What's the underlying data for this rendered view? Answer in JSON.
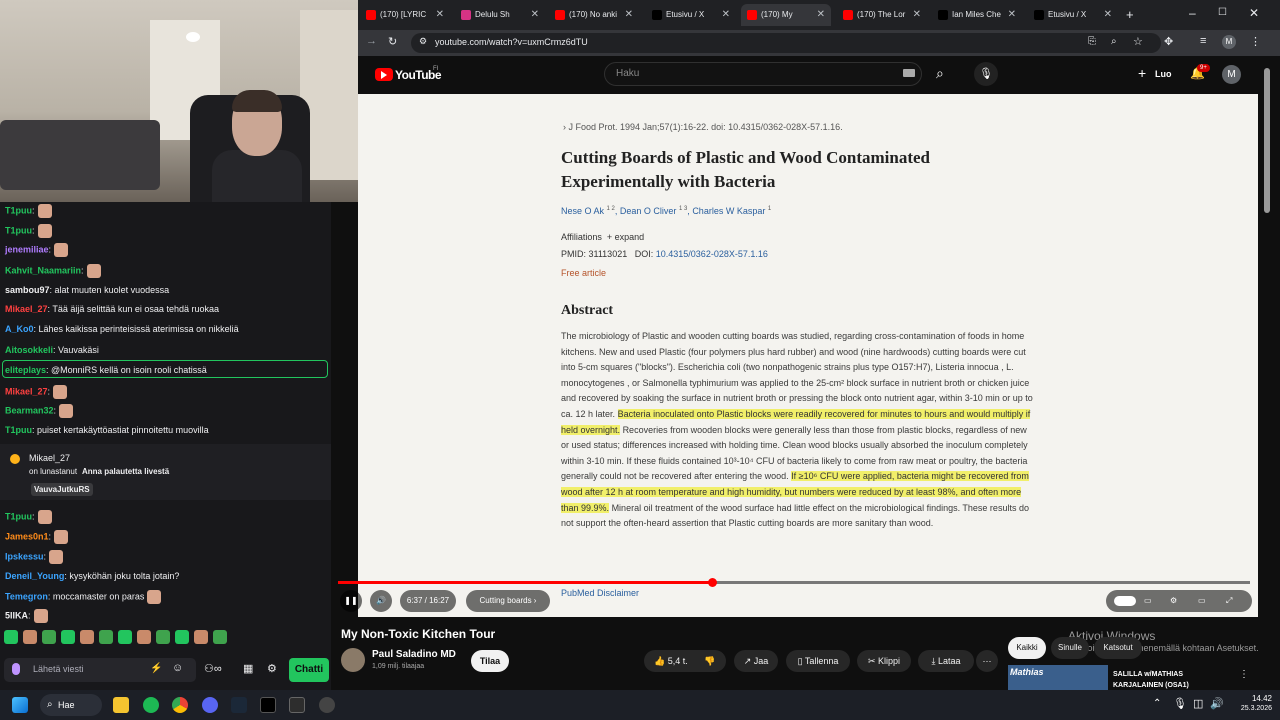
{
  "chat": {
    "lines": [
      {
        "user": "T1puu",
        "text": ":"
      },
      {
        "user": "T1puu",
        "text": ":"
      },
      {
        "user": "jenemiliae",
        "text": ":"
      },
      {
        "user": "Kahvit_Naamariin",
        "text": ":"
      },
      {
        "user": "sambou97",
        "text": ": alat muuten kuolet vuodessa"
      },
      {
        "user": "Mikael_27",
        "text": ": Tää äijä selittää kun ei osaa tehdä ruokaa"
      },
      {
        "user": "A_Ko0",
        "text": ": Lähes kaikissa perinteisissä aterimissa on nikkeliä"
      },
      {
        "user": "Aitosokkeli",
        "text": ": Vauvakäsi"
      },
      {
        "user": "eliteplays",
        "text": ": @MonniRS kellä on isoin rooli chatissä"
      },
      {
        "user": "Mikael_27",
        "text": ":"
      },
      {
        "user": "Bearman32",
        "text": ":"
      },
      {
        "user": "T1puu",
        "text": ": puiset kertakäyttöastiat pinnoitettu muovilla"
      },
      {
        "user": "T1puu",
        "text": ":"
      },
      {
        "user": "James0n1",
        "text": ":"
      },
      {
        "user": "Ipskessu",
        "text": ":"
      },
      {
        "user": "Deneil_Young",
        "text": ": kysyköhän joku tolta jotain?"
      },
      {
        "user": "Temegron",
        "text": ": moccamaster on paras"
      },
      {
        "user": "5IIKA",
        "text": ":"
      }
    ],
    "redeem": {
      "user": "Mikael_27",
      "text": "on lunastanut",
      "reward": "Anna palautetta livestä",
      "badge": "VauvaJutkuRS"
    },
    "input_placeholder": "Lähetä viesti",
    "send_label": "Chatti"
  },
  "browser": {
    "tabs": [
      "(170) [LYRIC",
      "Delulu Sh",
      "(170) No anki",
      "Etusivu / X",
      "(170) My",
      "(170) The Lor",
      "Ian Miles Che",
      "Etusivu / X"
    ],
    "url": "youtube.com/watch?v=uxmCrmz6dTU"
  },
  "youtube": {
    "logo": "YouTube",
    "region": "FI",
    "search_placeholder": "Haku",
    "create_label": "Luo",
    "notif_count": "9+",
    "avatar": "M",
    "article": {
      "journal": "J Food Prot. 1994 Jan;57(1):16-22. doi: 10.4315/0362-028X-57.1.16.",
      "title": "Cutting Boards of Plastic and Wood Contaminated Experimentally with Bacteria",
      "authors": [
        "Nese O Ak",
        "1  2",
        "Dean O Cliver",
        "1  3",
        "Charles W Kaspar",
        "1"
      ],
      "affiliations": "Affiliations",
      "expand": "+ expand",
      "pmid": "PMID: 31113021",
      "doi_label": "DOI:",
      "doi": "10.4315/0362-028X-57.1.16",
      "free": "Free article",
      "abstract_title": "Abstract",
      "abstract_p1": "The microbiology of Plastic and wooden cutting boards was studied, regarding cross-contamination of foods in home kitchens. New and used Plastic (four polymers plus hard rubber) and wood (nine hardwoods) cutting boards were cut into 5-cm squares (\"blocks\"). Escherichia coli (two nonpathogenic strains plus type O157:H7), Listeria innocua , L. monocytogenes , or Salmonella typhimurium was applied to the 25-cm² block surface in nutrient broth or chicken juice and recovered by soaking the surface in nutrient broth or pressing the block onto nutrient agar, within 3-10 min or up to ca. 12 h later.",
      "abstract_h1": "Bacteria inoculated onto Plastic blocks were readily recovered for minutes to hours and would multiply if held overnight.",
      "abstract_p2": "Recoveries from wooden blocks were generally less than those from plastic blocks, regardless of new or used status; differences increased with holding time. Clean wood blocks usually absorbed the inoculum completely within 3-10 min. If these fluids contained 10³-10⁴ CFU of bacteria likely to come from raw meat or poultry, the bacteria generally could not be recovered after entering the wood.",
      "abstract_h2": "If ≥10⁶ CFU were applied, bacteria might be recovered from wood after 12 h at room temperature and high humidity, but numbers were reduced by at least 98%, and often more than 99.9%.",
      "abstract_p3": "Mineral oil treatment of the wood surface had little effect on the microbiological findings. These results do not support the often-heard assertion that Plastic cutting boards are more sanitary than wood.",
      "disclaimer": "PubMed Disclaimer"
    },
    "player": {
      "time": "6:37 / 16:27",
      "chapter": "Cutting boards",
      "progress": 0.41
    },
    "video_title": "My Non-Toxic Kitchen Tour",
    "channel": "Paul Saladino MD",
    "subs": "1,09 milj. tilaajaa",
    "subscribe": "Tilaa",
    "likes": "5,4 t.",
    "share": "Jaa",
    "save": "Tallenna",
    "clip": "Klippi",
    "download": "Lataa",
    "chips": [
      "Kaikki",
      "Sinulle",
      "Katsotut"
    ],
    "activate": "Aktivoi Windows",
    "activate_sub": "Aktivoi Windows menemällä kohtaan Asetukset.",
    "rec_title": "SALILLA w/MATHIAS KARJALAINEN (OSA1)",
    "rec_thumb": "Mathias"
  },
  "taskbar": {
    "search": "Hae",
    "time": "14.42",
    "date": "25.3.2026"
  }
}
